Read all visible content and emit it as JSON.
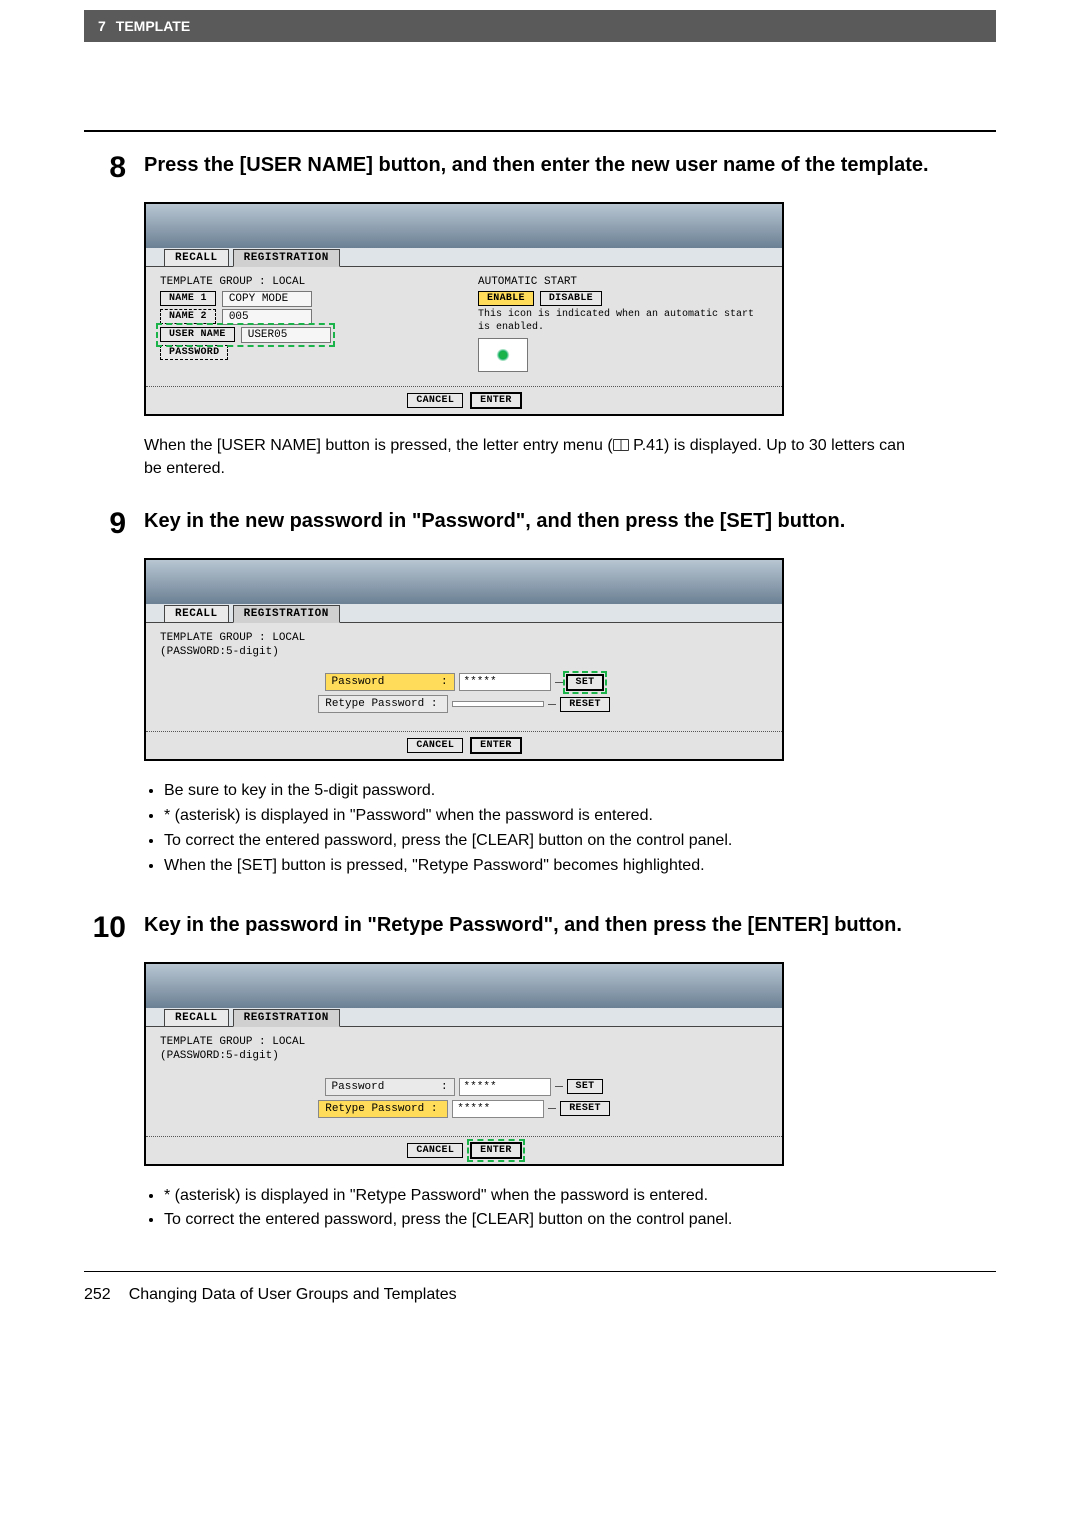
{
  "header": {
    "chapter_num": "7",
    "chapter_title": "TEMPLATE"
  },
  "step8": {
    "num": "8",
    "title": "Press the [USER NAME] button, and then enter the new user name of the template.",
    "para_before": "When the [USER NAME] button is pressed, the letter entry menu (",
    "para_ref": " P.41",
    "para_after": ") is displayed. Up to 30 letters can be entered."
  },
  "shot1": {
    "tabs": {
      "recall": "RECALL",
      "registration": "REGISTRATION"
    },
    "template_group": "TEMPLATE GROUP   : LOCAL",
    "name1_label": "NAME 1",
    "name1_val": "COPY MODE",
    "name2_label": "NAME 2",
    "name2_val": "005",
    "username_label": "USER NAME",
    "username_val": "USER05",
    "password_label": "PASSWORD",
    "auto_start": "AUTOMATIC START",
    "enable": "ENABLE",
    "disable": "DISABLE",
    "hint": "This icon is indicated when an automatic start is enabled.",
    "cancel": "CANCEL",
    "enter": "ENTER"
  },
  "step9": {
    "num": "9",
    "title": "Key in the new password in \"Password\", and then press the [SET] button."
  },
  "shot2": {
    "tabs": {
      "recall": "RECALL",
      "registration": "REGISTRATION"
    },
    "group": "TEMPLATE GROUP   : LOCAL",
    "pwnote": "(PASSWORD:5-digit)",
    "password_label": "Password",
    "password_val": "*****",
    "retype_label": "Retype Password  :",
    "set": "SET",
    "reset": "RESET",
    "cancel": "CANCEL",
    "enter": "ENTER"
  },
  "notes9": {
    "a": "Be sure to key in the 5-digit password.",
    "b": "* (asterisk) is displayed in \"Password\" when the password is entered.",
    "c": "To correct the entered password, press the [CLEAR] button on the control panel.",
    "d": "When the [SET] button is pressed, \"Retype Password\" becomes highlighted."
  },
  "step10": {
    "num": "10",
    "title": "Key in the password in \"Retype Password\", and then press the [ENTER] button."
  },
  "shot3": {
    "tabs": {
      "recall": "RECALL",
      "registration": "REGISTRATION"
    },
    "group": "TEMPLATE GROUP   : LOCAL",
    "pwnote": "(PASSWORD:5-digit)",
    "password_label": "Password",
    "password_val": "*****",
    "retype_label": "Retype Password  :",
    "retype_val": "*****",
    "set": "SET",
    "reset": "RESET",
    "cancel": "CANCEL",
    "enter": "ENTER"
  },
  "notes10": {
    "a": "* (asterisk) is displayed in \"Retype Password\" when the password is entered.",
    "b": "To correct the entered password, press the [CLEAR] button on the control panel."
  },
  "footer": {
    "page": "252",
    "title": "Changing Data of User Groups and Templates"
  }
}
